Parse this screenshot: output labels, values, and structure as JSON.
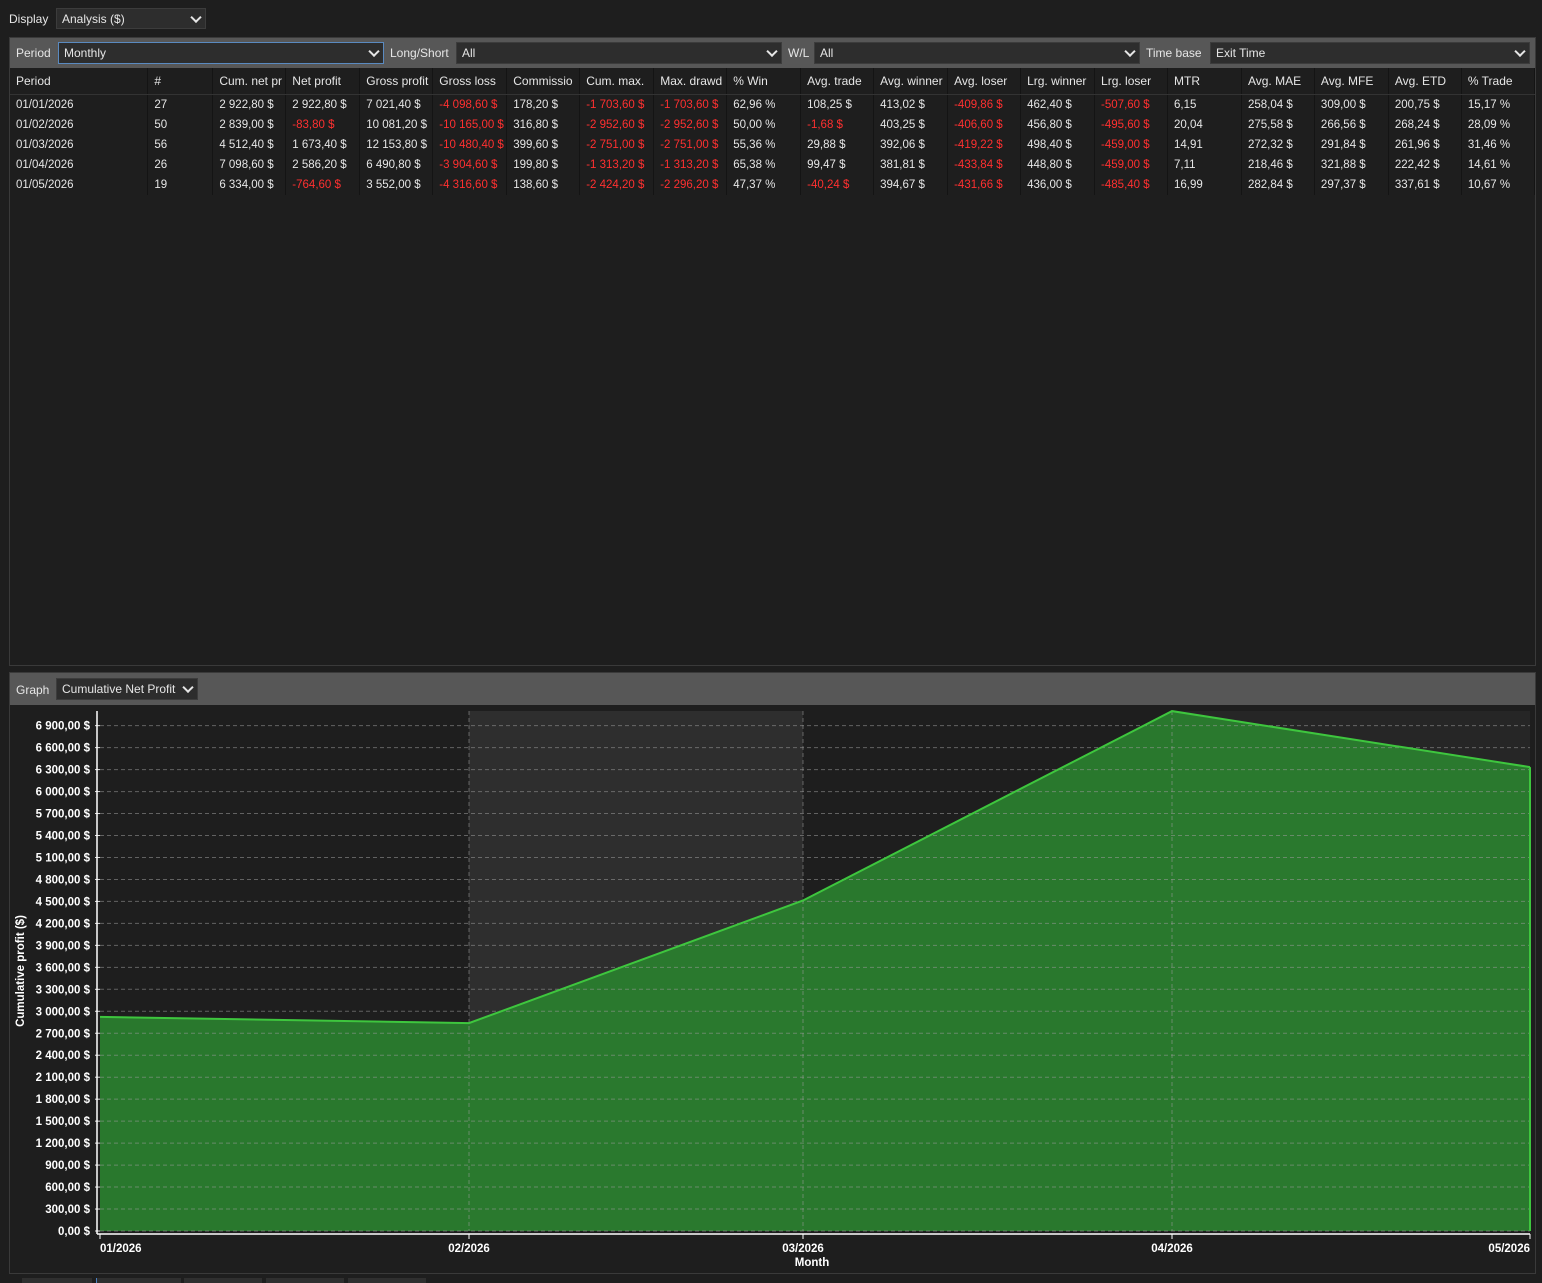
{
  "display": {
    "label": "Display",
    "value": "Analysis ($)"
  },
  "filters": {
    "period": {
      "label": "Period",
      "value": "Monthly"
    },
    "long_short": {
      "label": "Long/Short",
      "value": "All"
    },
    "wl": {
      "label": "W/L",
      "value": "All"
    },
    "time_base": {
      "label": "Time base",
      "value": "Exit Time"
    }
  },
  "table": {
    "columns": [
      "Period",
      "#",
      "Cum. net pr",
      "Net profit",
      "Gross profit",
      "Gross loss",
      "Commissio",
      "Cum. max.",
      "Max. drawd",
      "% Win",
      "Avg. trade",
      "Avg. winner",
      "Avg. loser",
      "Lrg. winner",
      "Lrg. loser",
      "MTR",
      "Avg. MAE",
      "Avg. MFE",
      "Avg. ETD",
      "% Trade"
    ],
    "rows": [
      [
        "01/01/2026",
        "27",
        "2 922,80 $",
        "2 922,80 $",
        "7 021,40 $",
        "-4 098,60 $",
        "178,20 $",
        "-1 703,60 $",
        "-1 703,60 $",
        "62,96 %",
        "108,25 $",
        "413,02 $",
        "-409,86 $",
        "462,40 $",
        "-507,60 $",
        "6,15",
        "258,04 $",
        "309,00 $",
        "200,75 $",
        "15,17 %"
      ],
      [
        "01/02/2026",
        "50",
        "2 839,00 $",
        "-83,80 $",
        "10 081,20 $",
        "-10 165,00 $",
        "316,80 $",
        "-2 952,60 $",
        "-2 952,60 $",
        "50,00 %",
        "-1,68 $",
        "403,25 $",
        "-406,60 $",
        "456,80 $",
        "-495,60 $",
        "20,04",
        "275,58 $",
        "266,56 $",
        "268,24 $",
        "28,09 %"
      ],
      [
        "01/03/2026",
        "56",
        "4 512,40 $",
        "1 673,40 $",
        "12 153,80 $",
        "-10 480,40 $",
        "399,60 $",
        "-2 751,00 $",
        "-2 751,00 $",
        "55,36 %",
        "29,88 $",
        "392,06 $",
        "-419,22 $",
        "498,40 $",
        "-459,00 $",
        "14,91",
        "272,32 $",
        "291,84 $",
        "261,96 $",
        "31,46 %"
      ],
      [
        "01/04/2026",
        "26",
        "7 098,60 $",
        "2 586,20 $",
        "6 490,80 $",
        "-3 904,60 $",
        "199,80 $",
        "-1 313,20 $",
        "-1 313,20 $",
        "65,38 %",
        "99,47 $",
        "381,81 $",
        "-433,84 $",
        "448,80 $",
        "-459,00 $",
        "7,11",
        "218,46 $",
        "321,88 $",
        "222,42 $",
        "14,61 %"
      ],
      [
        "01/05/2026",
        "19",
        "6 334,00 $",
        "-764,60 $",
        "3 552,00 $",
        "-4 316,60 $",
        "138,60 $",
        "-2 424,20 $",
        "-2 296,20 $",
        "47,37 %",
        "-40,24 $",
        "394,67 $",
        "-431,66 $",
        "436,00 $",
        "-485,40 $",
        "16,99",
        "282,84 $",
        "297,37 $",
        "337,61 $",
        "10,67 %"
      ]
    ]
  },
  "graph": {
    "label": "Graph",
    "value": "Cumulative Net Profit"
  },
  "colors": {
    "area_fill": "#2a7d2e",
    "area_line": "#3ec63e",
    "negative": "#ff3030",
    "band": "#2e2e2e"
  },
  "chart_data": {
    "type": "area",
    "categories": [
      "01/2026",
      "02/2026",
      "03/2026",
      "04/2026",
      "05/2026"
    ],
    "series": [
      {
        "values": [
          2922.8,
          2839.0,
          4512.4,
          7098.6,
          6334.0
        ]
      }
    ],
    "xlabel": "Month",
    "ylabel": "Cumulative profit ($)",
    "ylim": [
      0,
      7100
    ],
    "yticks": [
      0,
      300,
      600,
      900,
      1200,
      1500,
      1800,
      2100,
      2400,
      2700,
      3000,
      3300,
      3600,
      3900,
      4200,
      4500,
      4800,
      5100,
      5400,
      5700,
      6000,
      6300,
      6600,
      6900
    ],
    "ytick_labels": [
      "0,00 $",
      "300,00 $",
      "600,00 $",
      "900,00 $",
      "1 200,00 $",
      "1 500,00 $",
      "1 800,00 $",
      "2 100,00 $",
      "2 400,00 $",
      "2 700,00 $",
      "3 000,00 $",
      "3 300,00 $",
      "3 600,00 $",
      "3 900,00 $",
      "4 200,00 $",
      "4 500,00 $",
      "4 800,00 $",
      "5 100,00 $",
      "5 400,00 $",
      "5 700,00 $",
      "6 000,00 $",
      "6 300,00 $",
      "6 600,00 $",
      "6 900,00 $"
    ],
    "grid": true,
    "legend": "none"
  }
}
